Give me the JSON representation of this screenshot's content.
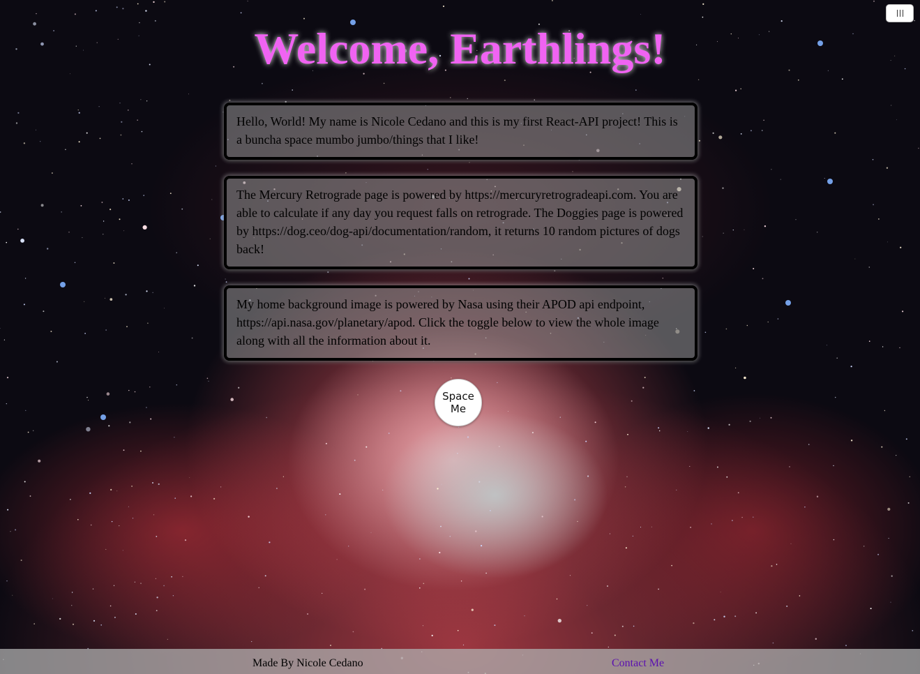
{
  "header": {
    "title": "Welcome, Earthlings!",
    "menu_icon": "hamburger-icon"
  },
  "cards": [
    {
      "text": "Hello, World! My name is Nicole Cedano and this is my first React-API project! This is a buncha space mumbo jumbo/things that I like!"
    },
    {
      "text": "The Mercury Retrograde page is powered by https://mercuryretrogradeapi.com. You are able to calculate if any day you request falls on retrograde. The Doggies page is powered by https://dog.ceo/dog-api/documentation/random, it returns 10 random pictures of dogs back!"
    },
    {
      "text": "My home background image is powered by Nasa using their APOD api endpoint, https://api.nasa.gov/planetary/apod. Click the toggle below to view the whole image along with all the information about it."
    }
  ],
  "toggle": {
    "label": "Space Me"
  },
  "footer": {
    "credit": "Made By Nicole Cedano",
    "contact_label": "Contact Me"
  },
  "colors": {
    "title": "#f063f2",
    "link": "#5a0fb0",
    "card_border": "#000000"
  }
}
